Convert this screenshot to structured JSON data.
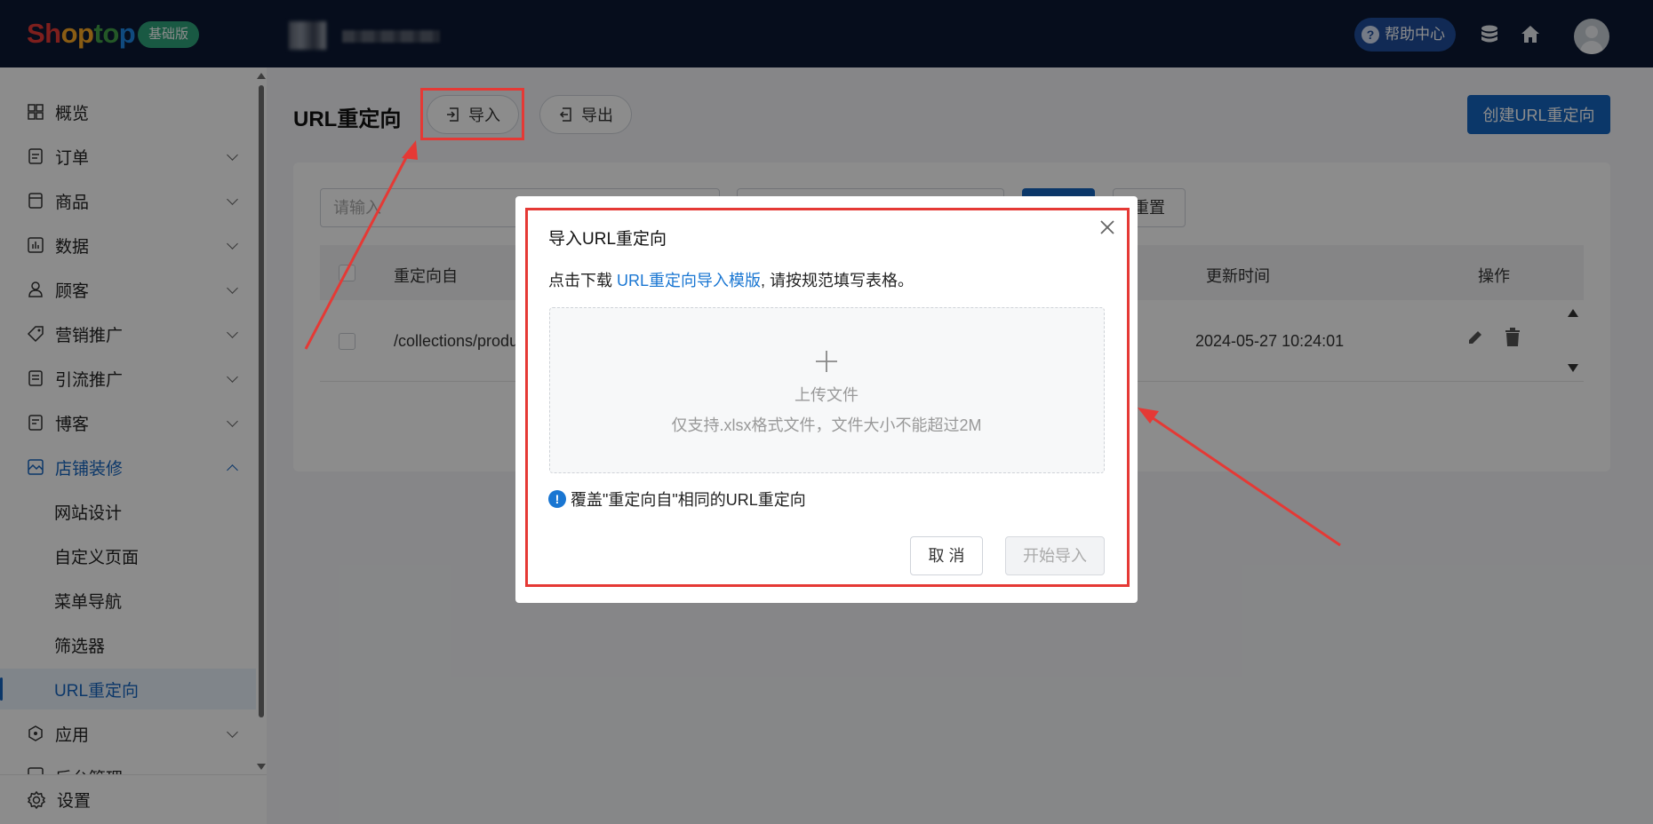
{
  "header": {
    "logo": [
      "Sh",
      "op",
      "to",
      "p"
    ],
    "plan_badge": "基础版",
    "help_label": "帮助中心",
    "help_glyph": "?",
    "icons": [
      "database-icon",
      "home-icon",
      "avatar"
    ]
  },
  "sidebar": {
    "items": [
      {
        "label": "概览",
        "icon": "dashboard-icon",
        "expandable": false
      },
      {
        "label": "订单",
        "icon": "order-icon",
        "expandable": true
      },
      {
        "label": "商品",
        "icon": "product-icon",
        "expandable": true
      },
      {
        "label": "数据",
        "icon": "chart-icon",
        "expandable": true
      },
      {
        "label": "顾客",
        "icon": "user-icon",
        "expandable": true
      },
      {
        "label": "营销推广",
        "icon": "tag-icon",
        "expandable": true
      },
      {
        "label": "引流推广",
        "icon": "doc-icon",
        "expandable": true
      },
      {
        "label": "博客",
        "icon": "blog-icon",
        "expandable": true
      },
      {
        "label": "店铺装修",
        "icon": "store-icon",
        "expandable": true,
        "expanded": true
      }
    ],
    "sub_items": [
      "网站设计",
      "自定义页面",
      "菜单导航",
      "筛选器",
      "URL重定向"
    ],
    "selected_sub": "URL重定向",
    "after_items": [
      {
        "label": "应用",
        "icon": "app-icon",
        "expandable": true
      },
      {
        "label": "后台管理",
        "icon": "admin-icon",
        "expandable": true
      }
    ],
    "settings_label": "设置"
  },
  "main": {
    "title": "URL重定向",
    "import_label": "导入",
    "export_label": "导出",
    "create_label": "创建URL重定向",
    "search_placeholder": "请输入",
    "reset_label": "重置",
    "table": {
      "columns": [
        "重定向自",
        "更新时间",
        "操作"
      ],
      "rows": [
        {
          "from": "/collections/produ",
          "updated": "2024-05-27 10:24:01"
        }
      ]
    }
  },
  "modal": {
    "title": "导入URL重定向",
    "desc_prefix": "点击下载 ",
    "template_link": "URL重定向导入模版",
    "desc_suffix": ", 请按规范填写表格。",
    "upload_label": "上传文件",
    "upload_hint": "仅支持.xlsx格式文件，文件大小不能超过2M",
    "overwrite_label": "覆盖\"重定向自\"相同的URL重定向",
    "info_glyph": "!",
    "cancel_label": "取 消",
    "start_label": "开始导入"
  },
  "colors": {
    "topbar": "#0b1833",
    "accent": "#1565c0",
    "annotation": "#e53935"
  }
}
